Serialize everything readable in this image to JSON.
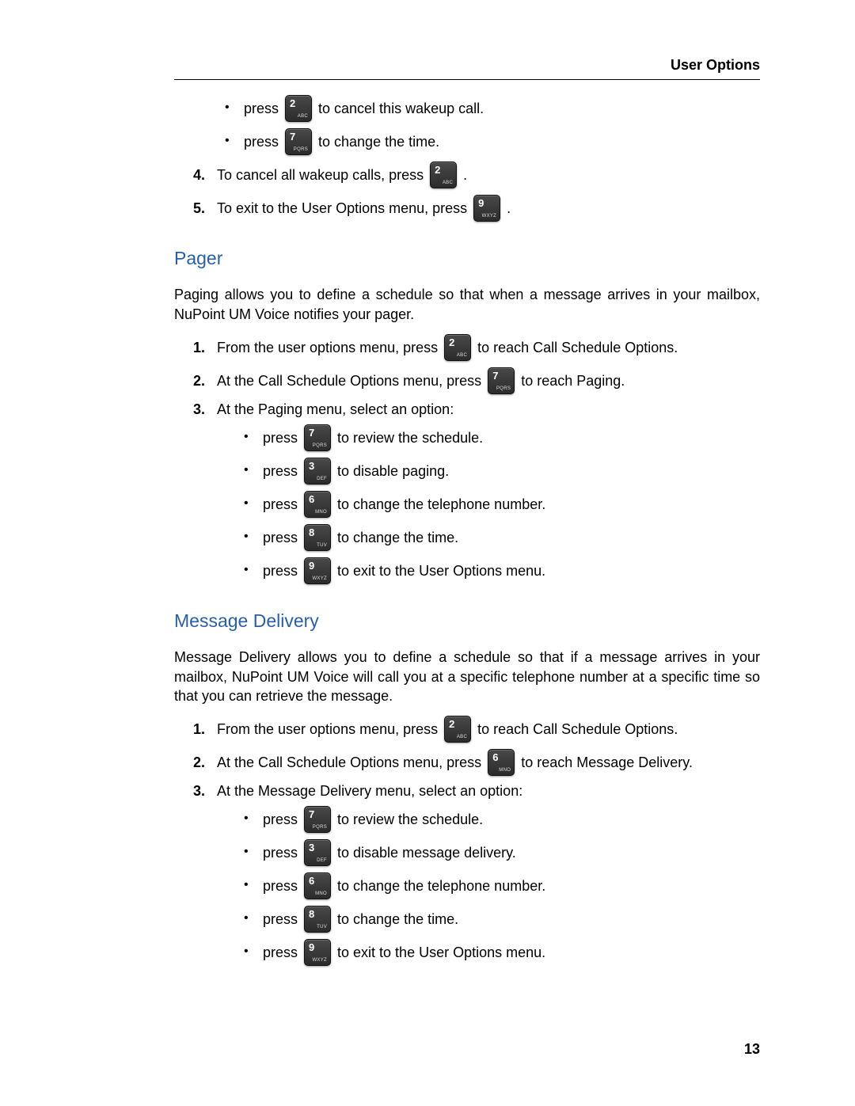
{
  "header": {
    "title": "User Options"
  },
  "footer": {
    "page_number": "13"
  },
  "keys": {
    "2": {
      "num": "2",
      "sub": "ABC"
    },
    "3": {
      "num": "3",
      "sub": "DEF"
    },
    "6": {
      "num": "6",
      "sub": "MNO"
    },
    "7": {
      "num": "7",
      "sub": "PQRS"
    },
    "8": {
      "num": "8",
      "sub": "TUV"
    },
    "9": {
      "num": "9",
      "sub": "WXYZ"
    }
  },
  "wakeup": {
    "sub": [
      {
        "before": "press",
        "key": "2",
        "after": "to cancel this wakeup call."
      },
      {
        "before": "press",
        "key": "7",
        "after": "to change the time."
      }
    ],
    "items": [
      {
        "num": "4.",
        "before": "To cancel all wakeup calls, press",
        "key": "2",
        "after": "."
      },
      {
        "num": "5.",
        "before": "To exit to the User Options menu, press",
        "key": "9",
        "after": "."
      }
    ]
  },
  "pager": {
    "heading": "Pager",
    "intro": "Paging allows you to define a schedule so that when a message arrives in your mailbox, NuPoint UM Voice notifies your pager.",
    "items": [
      {
        "num": "1.",
        "before": "From the user options menu, press",
        "key": "2",
        "after": "to reach Call Schedule Options."
      },
      {
        "num": "2.",
        "before": "At the Call Schedule Options menu, press",
        "key": "7",
        "after": "to reach Paging."
      },
      {
        "num": "3.",
        "text": "At the Paging menu, select an option:"
      }
    ],
    "sub": [
      {
        "before": "press",
        "key": "7",
        "after": "to review the schedule."
      },
      {
        "before": "press",
        "key": "3",
        "after": "to disable paging."
      },
      {
        "before": "press",
        "key": "6",
        "after": "to change the telephone number."
      },
      {
        "before": "press",
        "key": "8",
        "after": "to change the time."
      },
      {
        "before": "press",
        "key": "9",
        "after": "to exit to the User Options menu."
      }
    ]
  },
  "delivery": {
    "heading": "Message Delivery",
    "intro": "Message Delivery allows you to define a schedule so that if a message arrives in your mailbox, NuPoint UM Voice will call you at a specific telephone number at a specific time so that you can retrieve the message.",
    "items": [
      {
        "num": "1.",
        "before": "From the user options menu, press",
        "key": "2",
        "after": "to reach Call Schedule Options."
      },
      {
        "num": "2.",
        "before": "At the Call Schedule Options menu, press",
        "key": "6",
        "after": "to reach Message Delivery."
      },
      {
        "num": "3.",
        "text": "At the Message Delivery menu, select an option:"
      }
    ],
    "sub": [
      {
        "before": "press",
        "key": "7",
        "after": "to review the schedule."
      },
      {
        "before": "press",
        "key": "3",
        "after": "to disable message delivery."
      },
      {
        "before": "press",
        "key": "6",
        "after": "to change the telephone number."
      },
      {
        "before": "press",
        "key": "8",
        "after": "to change the time."
      },
      {
        "before": "press",
        "key": "9",
        "after": "to exit to the User Options menu."
      }
    ]
  }
}
